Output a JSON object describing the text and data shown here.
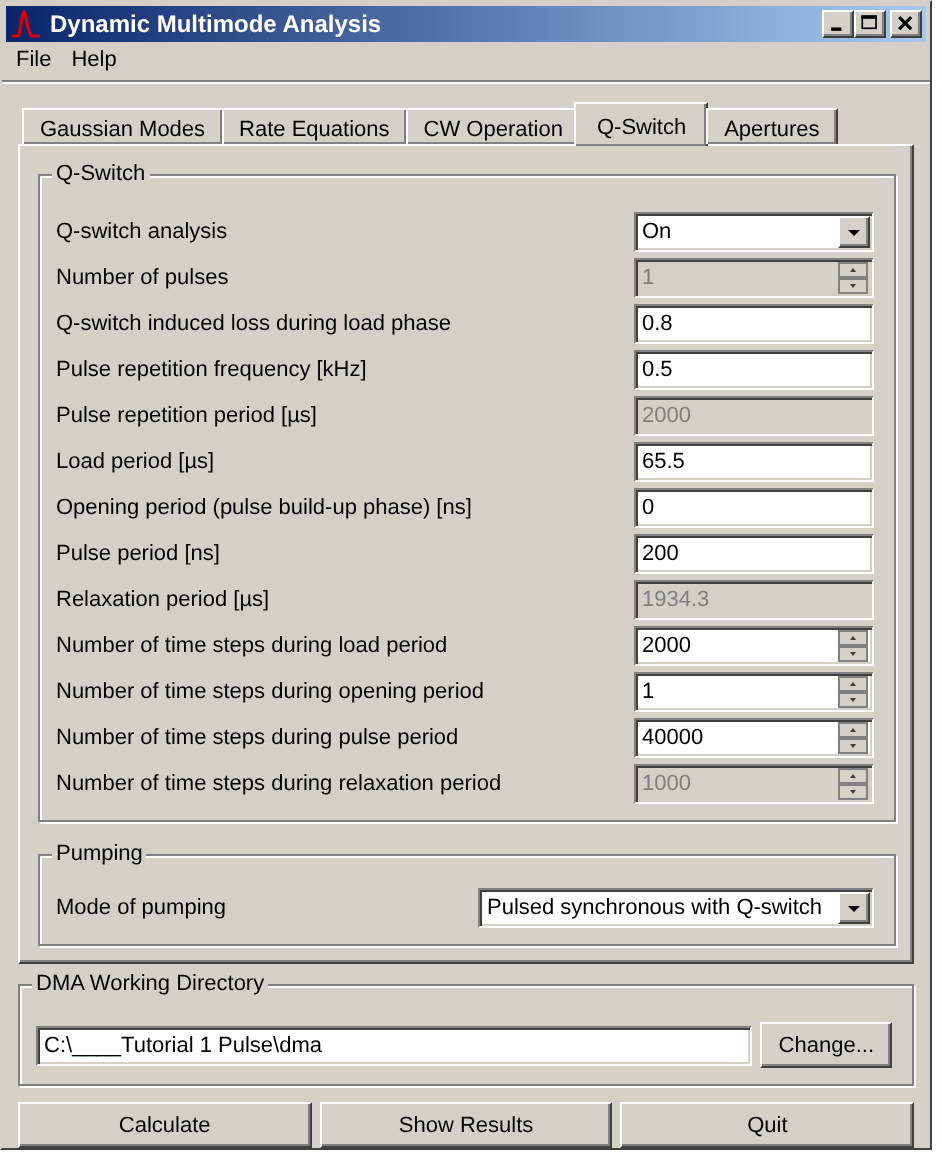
{
  "window": {
    "title": "Dynamic Multimode Analysis"
  },
  "menu": [
    "File",
    "Help"
  ],
  "tabs": [
    {
      "label": "Gaussian Modes",
      "selected": false
    },
    {
      "label": "Rate Equations",
      "selected": false
    },
    {
      "label": "CW Operation",
      "selected": false
    },
    {
      "label": "Q-Switch",
      "selected": true
    },
    {
      "label": "Apertures",
      "selected": false
    }
  ],
  "qswitch": {
    "title": "Q-Switch",
    "rows": [
      {
        "label": "Q-switch analysis",
        "kind": "dropdown",
        "value": "On",
        "disabled": false
      },
      {
        "label": "Number of pulses",
        "kind": "spin",
        "value": "1",
        "disabled": true
      },
      {
        "label": "Q-switch induced loss during load phase",
        "kind": "text",
        "value": "0.8",
        "disabled": false
      },
      {
        "label": "Pulse repetition frequency [kHz]",
        "kind": "text",
        "value": "0.5",
        "disabled": false
      },
      {
        "label": "Pulse repetition period [µs]",
        "kind": "text",
        "value": "2000",
        "disabled": true
      },
      {
        "label": "Load period [µs]",
        "kind": "text",
        "value": "65.5",
        "disabled": false
      },
      {
        "label": "Opening period (pulse build-up phase) [ns]",
        "kind": "text",
        "value": "0",
        "disabled": false
      },
      {
        "label": "Pulse period [ns]",
        "kind": "text",
        "value": "200",
        "disabled": false
      },
      {
        "label": "Relaxation period [µs]",
        "kind": "text",
        "value": "1934.3",
        "disabled": true
      },
      {
        "label": "Number of time steps during load period",
        "kind": "spin",
        "value": "2000",
        "disabled": false
      },
      {
        "label": "Number of time steps during opening period",
        "kind": "spin",
        "value": "1",
        "disabled": false
      },
      {
        "label": "Number of time steps during pulse period",
        "kind": "spin",
        "value": "40000",
        "disabled": false
      },
      {
        "label": "Number of time steps during relaxation period",
        "kind": "spin",
        "value": "1000",
        "disabled": true
      }
    ]
  },
  "pumping": {
    "title": "Pumping",
    "rows": [
      {
        "label": "Mode of pumping",
        "kind": "dropdown",
        "value": "Pulsed synchronous with Q-switch",
        "disabled": false
      }
    ]
  },
  "directory": {
    "title": "DMA Working Directory",
    "path": "C:\\____Tutorial 1 Pulse\\dma",
    "button": "Change..."
  },
  "buttons": [
    "Calculate",
    "Show Results",
    "Quit"
  ]
}
